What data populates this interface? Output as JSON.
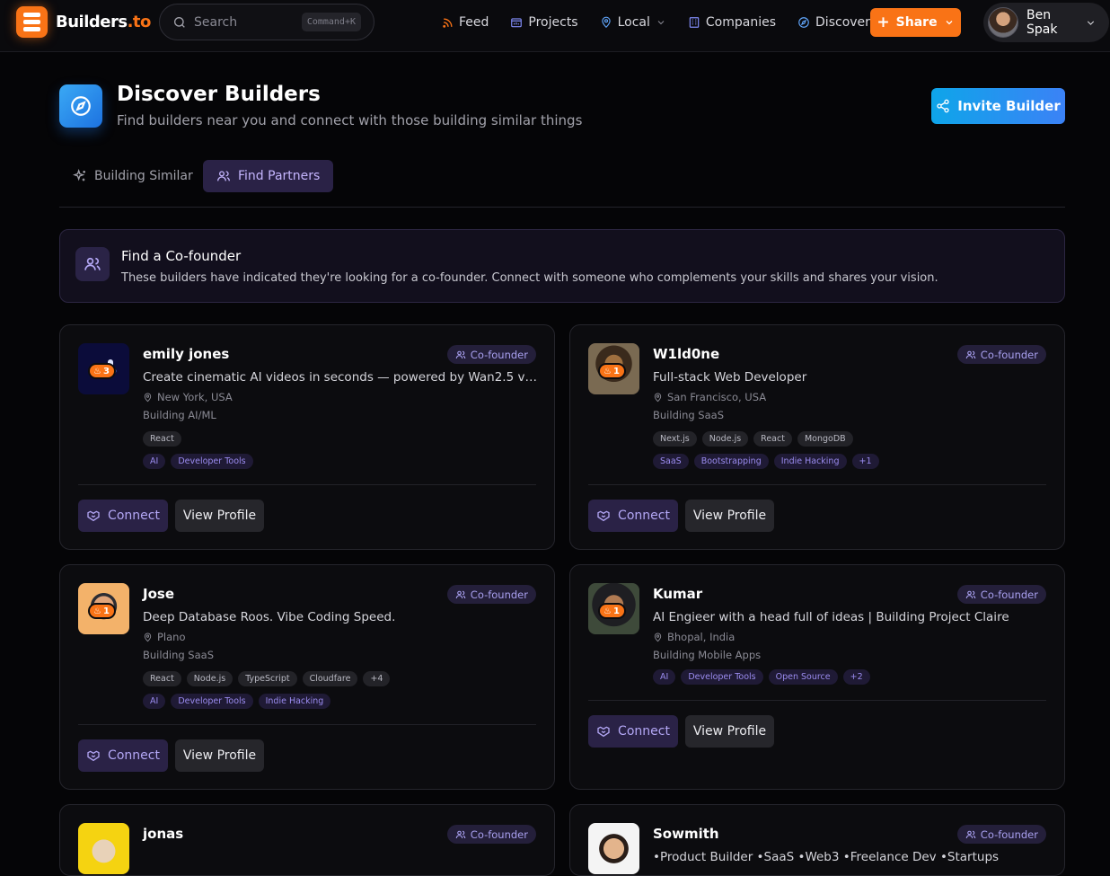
{
  "nav": {
    "brand_main": "Builders",
    "brand_tld": ".to",
    "search_placeholder": "Search",
    "search_shortcut": "Command+K",
    "links": [
      "Feed",
      "Projects",
      "Local",
      "Companies",
      "Discover"
    ],
    "share_label": "Share",
    "user_name": "Ben Spak"
  },
  "header": {
    "title": "Discover Builders",
    "subtitle": "Find builders near you and connect with those building similar things",
    "invite_label": "Invite Builder"
  },
  "tabs": [
    "Building Similar",
    "Find Partners"
  ],
  "banner": {
    "title": "Find a Co-founder",
    "text": "These builders have indicated they're looking for a co-founder. Connect with someone who complements your skills and shares your vision."
  },
  "cards": [
    {
      "name": "emily jones",
      "badge": "Co-founder",
      "desc": "Create cinematic AI videos in seconds — powered by Wan2.5 video...",
      "location": "New York, USA",
      "category": "Building AI/ML",
      "streak": "3",
      "tech": [
        "React"
      ],
      "tags": [
        "AI",
        "Developer Tools"
      ],
      "connect": "Connect",
      "view": "View Profile"
    },
    {
      "name": "W1ld0ne",
      "badge": "Co-founder",
      "desc": "Full-stack Web Developer",
      "location": "San Francisco, USA",
      "category": "Building SaaS",
      "streak": "1",
      "tech": [
        "Next.js",
        "Node.js",
        "React",
        "MongoDB"
      ],
      "tags": [
        "SaaS",
        "Bootstrapping",
        "Indie Hacking",
        "+1"
      ],
      "connect": "Connect",
      "view": "View Profile"
    },
    {
      "name": "Jose",
      "badge": "Co-founder",
      "desc": "Deep Database Roos. Vibe Coding Speed.",
      "location": "Plano",
      "category": "Building SaaS",
      "streak": "1",
      "tech": [
        "React",
        "Node.js",
        "TypeScript",
        "Cloudfare",
        "+4"
      ],
      "tags": [
        "AI",
        "Developer Tools",
        "Indie Hacking"
      ],
      "connect": "Connect",
      "view": "View Profile"
    },
    {
      "name": "Kumar",
      "badge": "Co-founder",
      "desc": "AI Engieer with a head full of ideas | Building Project Claire",
      "location": "Bhopal, India",
      "category": "Building Mobile Apps",
      "streak": "1",
      "tech": [],
      "tags": [
        "AI",
        "Developer Tools",
        "Open Source",
        "+2"
      ],
      "connect": "Connect",
      "view": "View Profile"
    },
    {
      "name": "jonas",
      "badge": "Co-founder"
    },
    {
      "name": "Sowmith",
      "badge": "Co-founder",
      "desc": "•Product Builder •SaaS •Web3 •Freelance Dev •Startups"
    }
  ]
}
